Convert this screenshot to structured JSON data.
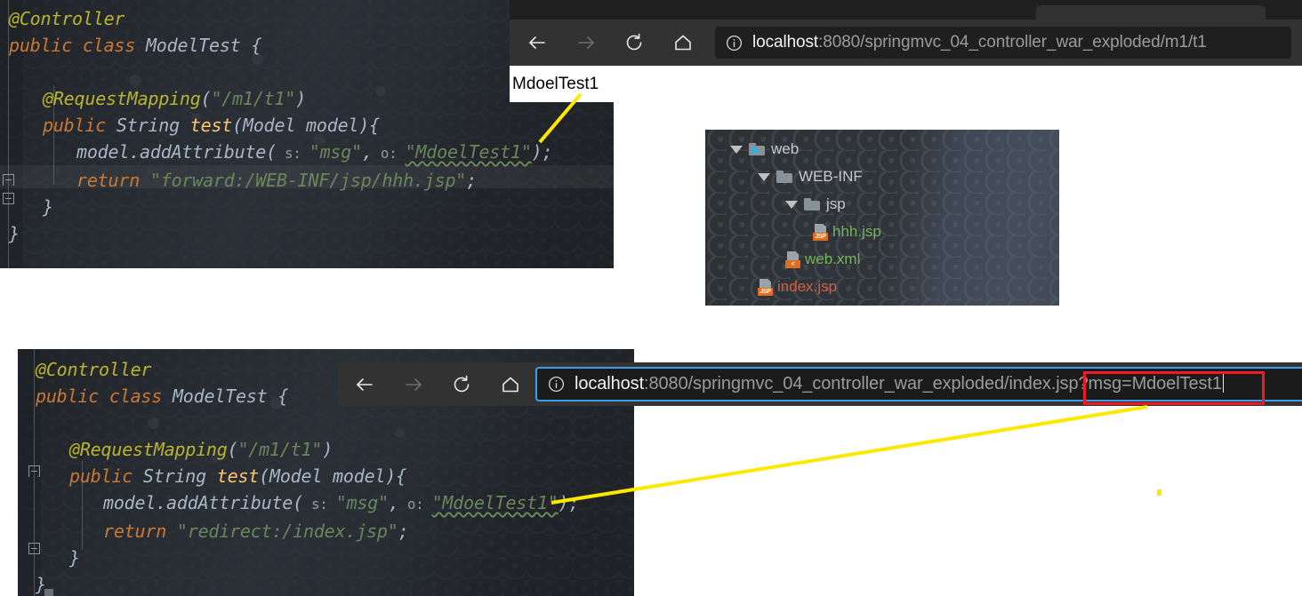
{
  "meta": {
    "accent_yellow": "#ffe800",
    "accent_red": "#ec1c24",
    "accent_blue": "#3aa0e8",
    "editor_bg": "#222528",
    "tree_bg": "#313335"
  },
  "top_editor": {
    "title": "ModelTest forward version",
    "lines": [
      {
        "indent": 0,
        "tokens": [
          {
            "t": "@Controller",
            "c": "ann"
          }
        ]
      },
      {
        "indent": 0,
        "tokens": [
          {
            "t": "public",
            "c": "kw"
          },
          {
            "t": " ",
            "c": "plain"
          },
          {
            "t": "class",
            "c": "kw"
          },
          {
            "t": " ",
            "c": "plain"
          },
          {
            "t": "ModelTest",
            "c": "cls"
          },
          {
            "t": " ",
            "c": "plain"
          },
          {
            "t": "{",
            "c": "brace"
          }
        ]
      },
      {
        "indent": 0,
        "tokens": []
      },
      {
        "indent": 1,
        "tokens": [
          {
            "t": "@RequestMapping",
            "c": "ann"
          },
          {
            "t": "(",
            "c": "brace"
          },
          {
            "t": "\"/m1/t1\"",
            "c": "str"
          },
          {
            "t": ")",
            "c": "brace"
          }
        ]
      },
      {
        "indent": 1,
        "tokens": [
          {
            "t": "public",
            "c": "kw"
          },
          {
            "t": " ",
            "c": "plain"
          },
          {
            "t": "String",
            "c": "cls"
          },
          {
            "t": " ",
            "c": "plain"
          },
          {
            "t": "test",
            "c": "meth"
          },
          {
            "t": "(",
            "c": "brace"
          },
          {
            "t": "Model model",
            "c": "cls"
          },
          {
            "t": "){",
            "c": "brace"
          }
        ]
      },
      {
        "indent": 2,
        "tokens": [
          {
            "t": "model.addAttribute",
            "c": "cls"
          },
          {
            "t": "(",
            "c": "brace"
          },
          {
            "t": " s: ",
            "c": "hint"
          },
          {
            "t": "\"msg\"",
            "c": "str"
          },
          {
            "t": ",",
            "c": "brace"
          },
          {
            "t": " o: ",
            "c": "hint"
          },
          {
            "t": "\"MdoelTest1\"",
            "c": "str typo"
          },
          {
            "t": ");",
            "c": "brace"
          }
        ]
      },
      {
        "indent": 2,
        "tokens": [
          {
            "t": "return",
            "c": "kw"
          },
          {
            "t": " ",
            "c": "plain"
          },
          {
            "t": "\"forward:/WEB-INF/jsp/hhh.jsp\"",
            "c": "str"
          },
          {
            "t": ";",
            "c": "brace"
          }
        ]
      },
      {
        "indent": 1,
        "tokens": [
          {
            "t": "}",
            "c": "brace"
          }
        ]
      },
      {
        "indent": 0,
        "tokens": [
          {
            "t": "}",
            "c": "brace"
          }
        ]
      }
    ],
    "highlighted_line_index": 6
  },
  "bottom_editor": {
    "title": "ModelTest redirect version",
    "lines": [
      {
        "indent": 0,
        "tokens": [
          {
            "t": "@Controller",
            "c": "ann"
          }
        ]
      },
      {
        "indent": 0,
        "tokens": [
          {
            "t": "public",
            "c": "kw"
          },
          {
            "t": " ",
            "c": "plain"
          },
          {
            "t": "class",
            "c": "kw"
          },
          {
            "t": " ",
            "c": "plain"
          },
          {
            "t": "ModelTest",
            "c": "cls"
          },
          {
            "t": " ",
            "c": "plain"
          },
          {
            "t": "{",
            "c": "brace"
          }
        ]
      },
      {
        "indent": 0,
        "tokens": []
      },
      {
        "indent": 1,
        "tokens": [
          {
            "t": "@RequestMapping",
            "c": "ann"
          },
          {
            "t": "(",
            "c": "brace"
          },
          {
            "t": "\"/m1/t1\"",
            "c": "str"
          },
          {
            "t": ")",
            "c": "brace"
          }
        ]
      },
      {
        "indent": 1,
        "tokens": [
          {
            "t": "public",
            "c": "kw"
          },
          {
            "t": " ",
            "c": "plain"
          },
          {
            "t": "String",
            "c": "cls"
          },
          {
            "t": " ",
            "c": "plain"
          },
          {
            "t": "test",
            "c": "meth"
          },
          {
            "t": "(",
            "c": "brace"
          },
          {
            "t": "Model model",
            "c": "cls"
          },
          {
            "t": "){",
            "c": "brace"
          }
        ]
      },
      {
        "indent": 2,
        "tokens": [
          {
            "t": "model.addAttribute",
            "c": "cls"
          },
          {
            "t": "(",
            "c": "brace"
          },
          {
            "t": " s: ",
            "c": "hint"
          },
          {
            "t": "\"msg\"",
            "c": "str"
          },
          {
            "t": ",",
            "c": "brace"
          },
          {
            "t": " o: ",
            "c": "hint"
          },
          {
            "t": "\"MdoelTest1\"",
            "c": "str typo"
          },
          {
            "t": ");",
            "c": "brace"
          }
        ]
      },
      {
        "indent": 2,
        "tokens": [
          {
            "t": "return",
            "c": "kw"
          },
          {
            "t": " ",
            "c": "plain"
          },
          {
            "t": "\"redirect:/index.jsp\"",
            "c": "str"
          },
          {
            "t": ";",
            "c": "brace"
          }
        ]
      },
      {
        "indent": 1,
        "tokens": [
          {
            "t": "}",
            "c": "brace"
          }
        ]
      },
      {
        "indent": 0,
        "tokens": [
          {
            "t": "}",
            "c": "brace"
          }
        ]
      }
    ],
    "highlighted_line_index": -1
  },
  "top_browser": {
    "back_label": "Back",
    "forward_label": "Forward",
    "reload_label": "Reload",
    "home_label": "Home",
    "site_info_label": "View site information",
    "url_host": "localhost",
    "url_rest": ":8080/springmvc_04_controller_war_exploded/m1/t1",
    "focused": false,
    "page_body_text": "MdoelTest1"
  },
  "bottom_browser": {
    "back_label": "Back",
    "forward_label": "Forward",
    "reload_label": "Reload",
    "home_label": "Home",
    "site_info_label": "View site information",
    "url_host": "localhost",
    "url_rest": ":8080/springmvc_04_controller_war_exploded/index.jsp",
    "url_query": "?msg=MdoelTest1",
    "focused": true,
    "highlight_color": "#ec1c24"
  },
  "project_tree": {
    "title": "Project files",
    "rows": [
      {
        "label": "web",
        "depth": 0,
        "expanded": true,
        "kind": "folder-module",
        "color": "folder"
      },
      {
        "label": "WEB-INF",
        "depth": 1,
        "expanded": true,
        "kind": "folder",
        "color": "folder"
      },
      {
        "label": "jsp",
        "depth": 2,
        "expanded": true,
        "kind": "folder",
        "color": "folder"
      },
      {
        "label": "hhh.jsp",
        "depth": 3,
        "expanded": false,
        "kind": "file-jsp",
        "color": "green",
        "badge": "JSP"
      },
      {
        "label": "web.xml",
        "depth": 2,
        "expanded": false,
        "kind": "file-xml",
        "color": "green",
        "badge": "<"
      },
      {
        "label": "index.jsp",
        "depth": 1,
        "expanded": false,
        "kind": "file-jsp",
        "color": "red",
        "badge": "JSP"
      }
    ]
  },
  "annotations": {
    "top_callout_text": "MdoelTest1",
    "arrow_color": "#ffe800",
    "dot_color": "#ffe800"
  }
}
